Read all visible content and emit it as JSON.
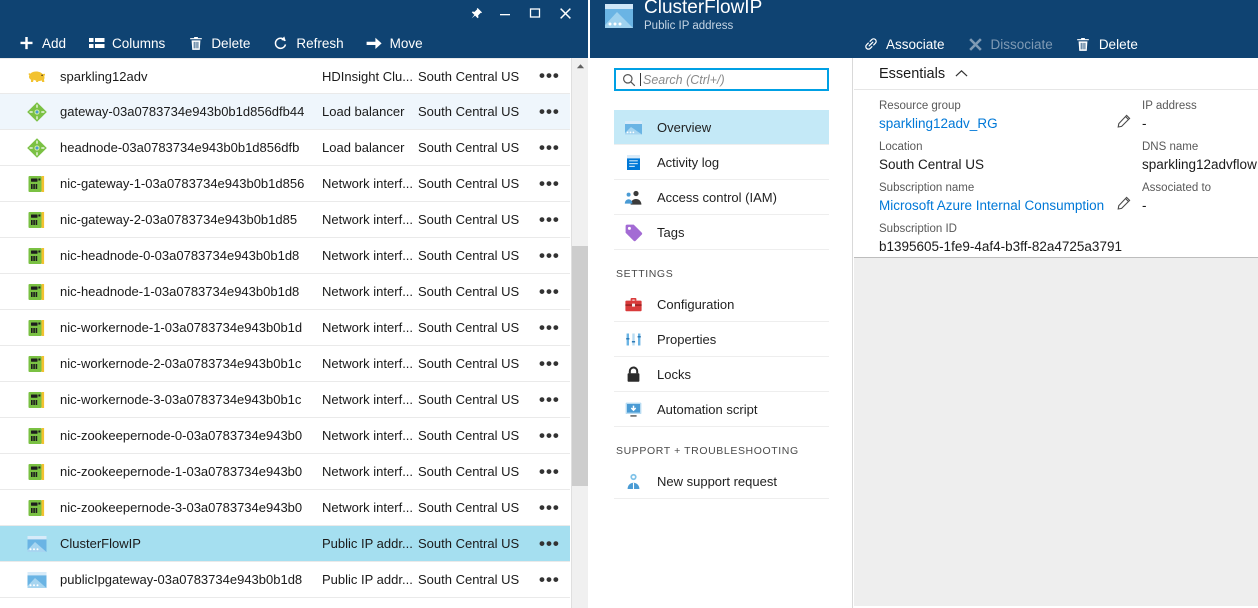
{
  "left_blade": {
    "window_controls": [
      {
        "name": "pin",
        "label": "Pin"
      },
      {
        "name": "minimize",
        "label": "Minimize"
      },
      {
        "name": "maximize",
        "label": "Maximize"
      },
      {
        "name": "close",
        "label": "Close"
      }
    ],
    "toolbar": [
      {
        "icon": "plus-icon",
        "label": "Add",
        "disabled": false
      },
      {
        "icon": "columns-icon",
        "label": "Columns",
        "disabled": false
      },
      {
        "icon": "trash-icon",
        "label": "Delete",
        "disabled": false
      },
      {
        "icon": "refresh-icon",
        "label": "Refresh",
        "disabled": false
      },
      {
        "icon": "arrow-right-icon",
        "label": "Move",
        "disabled": false
      }
    ],
    "rows": [
      {
        "icon": "hdinsight-icon",
        "name": "sparkling12adv",
        "type": "HDInsight Clu...",
        "location": "South Central US",
        "state": "normal"
      },
      {
        "icon": "load-balancer-icon",
        "name": "gateway-03a0783734e943b0b1d856dfb44",
        "type": "Load balancer",
        "location": "South Central US",
        "state": "hover"
      },
      {
        "icon": "load-balancer-icon",
        "name": "headnode-03a0783734e943b0b1d856dfb",
        "type": "Load balancer",
        "location": "South Central US",
        "state": "normal"
      },
      {
        "icon": "nic-icon",
        "name": "nic-gateway-1-03a0783734e943b0b1d856",
        "type": "Network interf...",
        "location": "South Central US",
        "state": "normal"
      },
      {
        "icon": "nic-icon",
        "name": "nic-gateway-2-03a0783734e943b0b1d85",
        "type": "Network interf...",
        "location": "South Central US",
        "state": "normal"
      },
      {
        "icon": "nic-icon",
        "name": "nic-headnode-0-03a0783734e943b0b1d8",
        "type": "Network interf...",
        "location": "South Central US",
        "state": "normal"
      },
      {
        "icon": "nic-icon",
        "name": "nic-headnode-1-03a0783734e943b0b1d8",
        "type": "Network interf...",
        "location": "South Central US",
        "state": "normal"
      },
      {
        "icon": "nic-icon",
        "name": "nic-workernode-1-03a0783734e943b0b1d",
        "type": "Network interf...",
        "location": "South Central US",
        "state": "normal"
      },
      {
        "icon": "nic-icon",
        "name": "nic-workernode-2-03a0783734e943b0b1c",
        "type": "Network interf...",
        "location": "South Central US",
        "state": "normal"
      },
      {
        "icon": "nic-icon",
        "name": "nic-workernode-3-03a0783734e943b0b1c",
        "type": "Network interf...",
        "location": "South Central US",
        "state": "normal"
      },
      {
        "icon": "nic-icon",
        "name": "nic-zookeepernode-0-03a0783734e943b0",
        "type": "Network interf...",
        "location": "South Central US",
        "state": "normal"
      },
      {
        "icon": "nic-icon",
        "name": "nic-zookeepernode-1-03a0783734e943b0",
        "type": "Network interf...",
        "location": "South Central US",
        "state": "normal"
      },
      {
        "icon": "nic-icon",
        "name": "nic-zookeepernode-3-03a0783734e943b0",
        "type": "Network interf...",
        "location": "South Central US",
        "state": "normal"
      },
      {
        "icon": "public-ip-icon",
        "name": "ClusterFlowIP",
        "type": "Public IP addr...",
        "location": "South Central US",
        "state": "selected"
      },
      {
        "icon": "public-ip-icon",
        "name": "publicIpgateway-03a0783734e943b0b1d8",
        "type": "Public IP addr...",
        "location": "South Central US",
        "state": "normal"
      }
    ]
  },
  "right_blade": {
    "resource": {
      "icon": "public-ip-icon",
      "title": "ClusterFlowIP",
      "subtitle": "Public IP address"
    },
    "toolbar": [
      {
        "icon": "link-icon",
        "label": "Associate",
        "disabled": false
      },
      {
        "icon": "x-icon",
        "label": "Dissociate",
        "disabled": true
      },
      {
        "icon": "trash-icon",
        "label": "Delete",
        "disabled": false
      }
    ],
    "search": {
      "placeholder": "Search (Ctrl+/)",
      "value": ""
    },
    "menu": [
      {
        "icon": "overview-icon",
        "label": "Overview",
        "active": true
      },
      {
        "icon": "activity-log-icon",
        "label": "Activity log",
        "active": false
      },
      {
        "icon": "access-control-icon",
        "label": "Access control (IAM)",
        "active": false
      },
      {
        "icon": "tags-icon",
        "label": "Tags",
        "active": false
      }
    ],
    "section_settings_label": "SETTINGS",
    "settings_menu": [
      {
        "icon": "configuration-icon",
        "label": "Configuration",
        "active": false
      },
      {
        "icon": "properties-icon",
        "label": "Properties",
        "active": false
      },
      {
        "icon": "lock-icon",
        "label": "Locks",
        "active": false
      },
      {
        "icon": "automation-script-icon",
        "label": "Automation script",
        "active": false
      }
    ],
    "section_support_label": "SUPPORT + TROUBLESHOOTING",
    "support_menu": [
      {
        "icon": "support-request-icon",
        "label": "New support request",
        "active": false
      }
    ],
    "essentials": {
      "header": "Essentials",
      "left_fields": [
        {
          "label": "Resource group",
          "value": "sparkling12adv_RG",
          "link": true,
          "editable": true
        },
        {
          "label": "Location",
          "value": "South Central US",
          "link": false,
          "editable": false
        },
        {
          "label": "Subscription name",
          "value": "Microsoft Azure Internal Consumption",
          "link": true,
          "editable": true
        },
        {
          "label": "Subscription ID",
          "value": "b1395605-1fe9-4af4-b3ff-82a4725a3791",
          "link": false,
          "editable": false
        }
      ],
      "right_fields": [
        {
          "label": "IP address",
          "value": "-",
          "link": false,
          "editable": false
        },
        {
          "label": "DNS name",
          "value": "sparkling12advflow",
          "link": false,
          "editable": false
        },
        {
          "label": "Associated to",
          "value": "-",
          "link": false,
          "editable": false
        }
      ]
    }
  },
  "colors": {
    "chrome_blue": "#0f4372",
    "selection_blue": "#a5dff0",
    "hover_blue": "#eff6fc",
    "menu_active_blue": "#c4e9f7",
    "link_blue": "#0078d7",
    "accent_cyan": "#00a0e4",
    "content_gray": "#eeeeee"
  }
}
